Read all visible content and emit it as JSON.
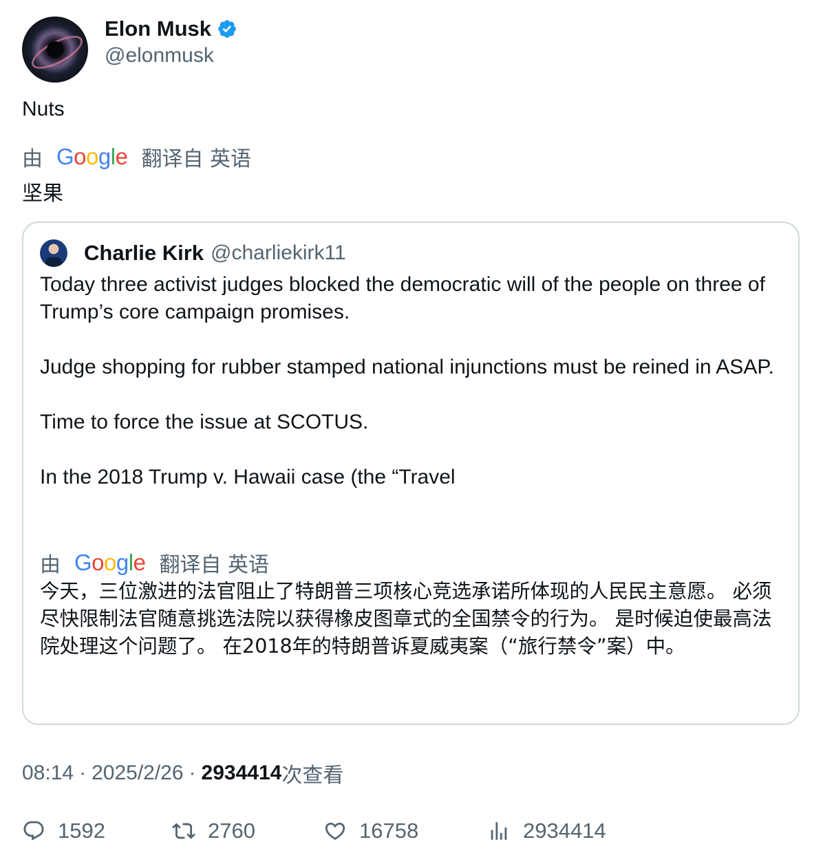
{
  "author": {
    "display_name": "Elon Musk",
    "handle": "@elonmusk",
    "verified_icon": "verified-badge-icon"
  },
  "tweet": {
    "text": "Nuts",
    "translation": {
      "prefix": "由",
      "provider": "Google",
      "suffix": "翻译自 英语",
      "text": "坚果"
    }
  },
  "quote": {
    "display_name": "Charlie Kirk",
    "handle": "@charliekirk11",
    "paragraphs": [
      "Today three activist judges blocked the democratic will of the people on three of Trump’s core campaign promises.",
      "Judge shopping for rubber stamped national injunctions must be reined in ASAP.",
      "Time to force the issue at SCOTUS.",
      "In the 2018 Trump v. Hawaii case (the “Travel"
    ],
    "translation": {
      "prefix": "由",
      "provider": "Google",
      "suffix": "翻译自 英语",
      "text": "今天，三位激进的法官阻止了特朗普三项核心竞选承诺所体现的人民民主意愿。 必须尽快限制法官随意挑选法院以获得橡皮图章式的全国禁令的行为。 是时候迫使最高法院处理这个问题了。 在2018年的特朗普诉夏威夷案（“旅行禁令”案）中。"
    }
  },
  "meta": {
    "time": "08:14",
    "separator": "·",
    "date": "2025/2/26",
    "views_count": "2934414",
    "views_label": "次查看"
  },
  "actions": {
    "replies": "1592",
    "retweets": "2760",
    "likes": "16758",
    "views": "2934414"
  },
  "colors": {
    "text_primary": "#0f1419",
    "text_secondary": "#536471",
    "border": "#cfd9de",
    "verified": "#1d9bf0"
  }
}
